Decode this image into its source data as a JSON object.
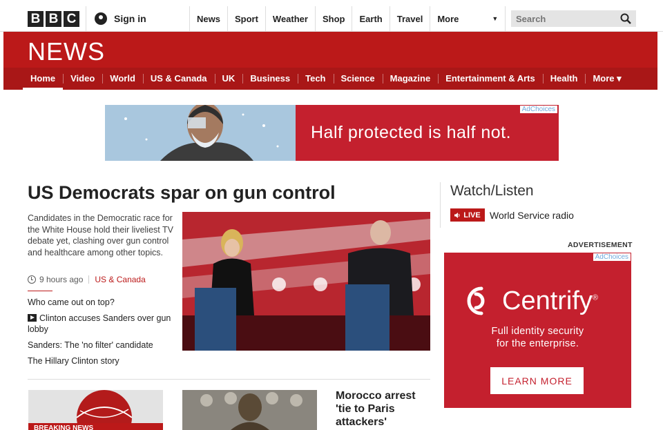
{
  "brand": {
    "logo_letters": [
      "B",
      "B",
      "C"
    ]
  },
  "account": {
    "signin_label": "Sign in"
  },
  "top_nav": {
    "items": [
      "News",
      "Sport",
      "Weather",
      "Shop",
      "Earth",
      "Travel"
    ],
    "more_label": "More"
  },
  "search": {
    "placeholder": "Search"
  },
  "news": {
    "title": "NEWS",
    "nav": [
      "Home",
      "Video",
      "World",
      "US & Canada",
      "UK",
      "Business",
      "Tech",
      "Science",
      "Magazine",
      "Entertainment & Arts",
      "Health"
    ],
    "nav_more_label": "More",
    "active_item": "Home"
  },
  "top_ad": {
    "text": "Half protected is half not.",
    "adchoices": "AdChoices"
  },
  "main_story": {
    "headline": "US Democrats spar on gun control",
    "summary": "Candidates in the Democratic race for the White House hold their liveliest TV debate yet, clashing over gun control and healthcare among other topics.",
    "time": "9 hours ago",
    "category": "US & Canada",
    "related": [
      "Who came out on top?",
      "Clinton accuses Sanders over gun lobby",
      "Sanders: The 'no filter' candidate",
      "The Hillary Clinton story"
    ]
  },
  "secondary": {
    "thumb1_caption": "BREAKING NEWS",
    "story3_headline": "Morocco arrest 'tie to Paris attackers'"
  },
  "watch_listen": {
    "title": "Watch/Listen",
    "live_label": "LIVE",
    "live_item": "World Service radio"
  },
  "side_ad": {
    "advert_label": "ADVERTISEMENT",
    "adchoices": "AdChoices",
    "brand": "Centrify",
    "tagline_line1": "Full identity security",
    "tagline_line2": "for the enterprise.",
    "cta": "LEARN MORE"
  },
  "colors": {
    "bbc_red": "#bb1919",
    "nav_red": "#a91717",
    "ad_red": "#c4202e"
  }
}
